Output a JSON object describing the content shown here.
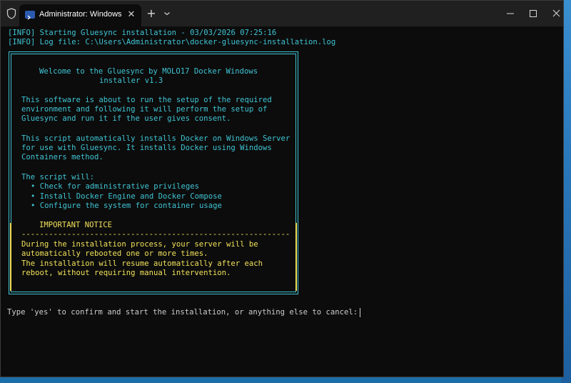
{
  "window": {
    "tab_title": "Administrator: Windows PowerShell",
    "new_tab_label": "+",
    "close_tab_label": "✕"
  },
  "terminal": {
    "info_lines": [
      "[INFO] Starting Gluesync installation - 03/03/2026 07:25:16",
      "[INFO] Log file: C:\\Users\\Administrator\\docker-gluesync-installation.log"
    ],
    "welcome": [
      "Welcome to the Gluesync by MOLO17 Docker Windows",
      "installer v1.3"
    ],
    "intro": [
      "This software is about to run the setup of the required",
      "environment and following it will perform the setup of",
      "Gluesync and run it if the user gives consent."
    ],
    "script_desc": [
      "This script automatically installs Docker on Windows Server",
      "for use with Gluesync. It installs Docker using Windows",
      "Containers method."
    ],
    "will_header": "The script will:",
    "will_items": [
      "• Check for administrative privileges",
      "• Install Docker Engine and Docker Compose",
      "• Configure the system for container usage"
    ],
    "notice_title": "IMPORTANT NOTICE",
    "notice_rule": "-----------------------------------------------------------",
    "notice_lines": [
      "During the installation process, your server will be",
      "automatically rebooted one or more times.",
      "The installation will resume automatically after each",
      "reboot, without requiring manual intervention."
    ],
    "prompt": "Type 'yes' to confirm and start the installation, or anything else to cancel:"
  },
  "colors": {
    "info": "#3fc4d4",
    "notice": "#f1e05a",
    "prompt": "#cccccc",
    "background": "#0c0c0c"
  },
  "icons": [
    "shield-icon",
    "powershell-icon",
    "close-icon",
    "plus-icon",
    "chevron-down-icon",
    "minimize-icon",
    "maximize-icon",
    "close-window-icon"
  ]
}
